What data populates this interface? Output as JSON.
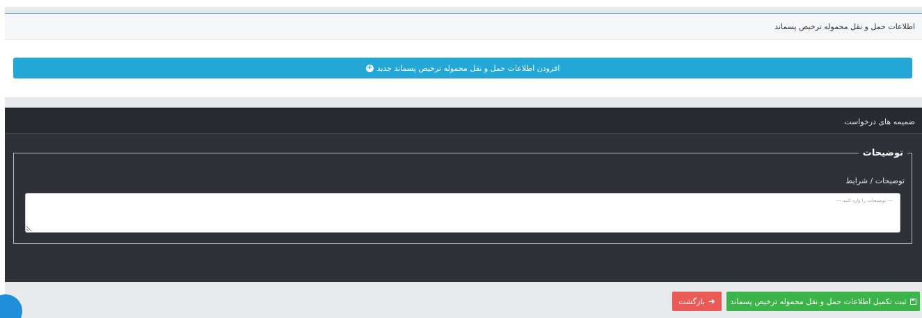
{
  "transport_panel": {
    "title": "اطلاعات حمل و نقل محموله ترخیص پسماند",
    "add_button_label": "افزودن اطلاعات حمل و نقل محموله ترخیص پسماند جدید",
    "add_icon": "plus-circle-icon"
  },
  "attachments_panel": {
    "title": "ضمیمه های درخواست",
    "description_legend": "توضیحات",
    "description_label": "توضیحات / شرایط",
    "description_value": "",
    "description_placeholder": "--- توضیحات را وارد کنید ---"
  },
  "footer": {
    "save_label": "ثبت تکمیل اطلاعات حمل و نقل محموله ترخیص پسماند",
    "save_icon": "floppy-disk-icon",
    "back_label": "بازگشت",
    "back_icon": "arrow-right-icon"
  },
  "colors": {
    "add_button": "#22a7d6",
    "dark_panel": "#2e3137",
    "save_button": "#3bb54a",
    "back_button": "#ec5a58",
    "header_accent": "#5bc0de"
  }
}
